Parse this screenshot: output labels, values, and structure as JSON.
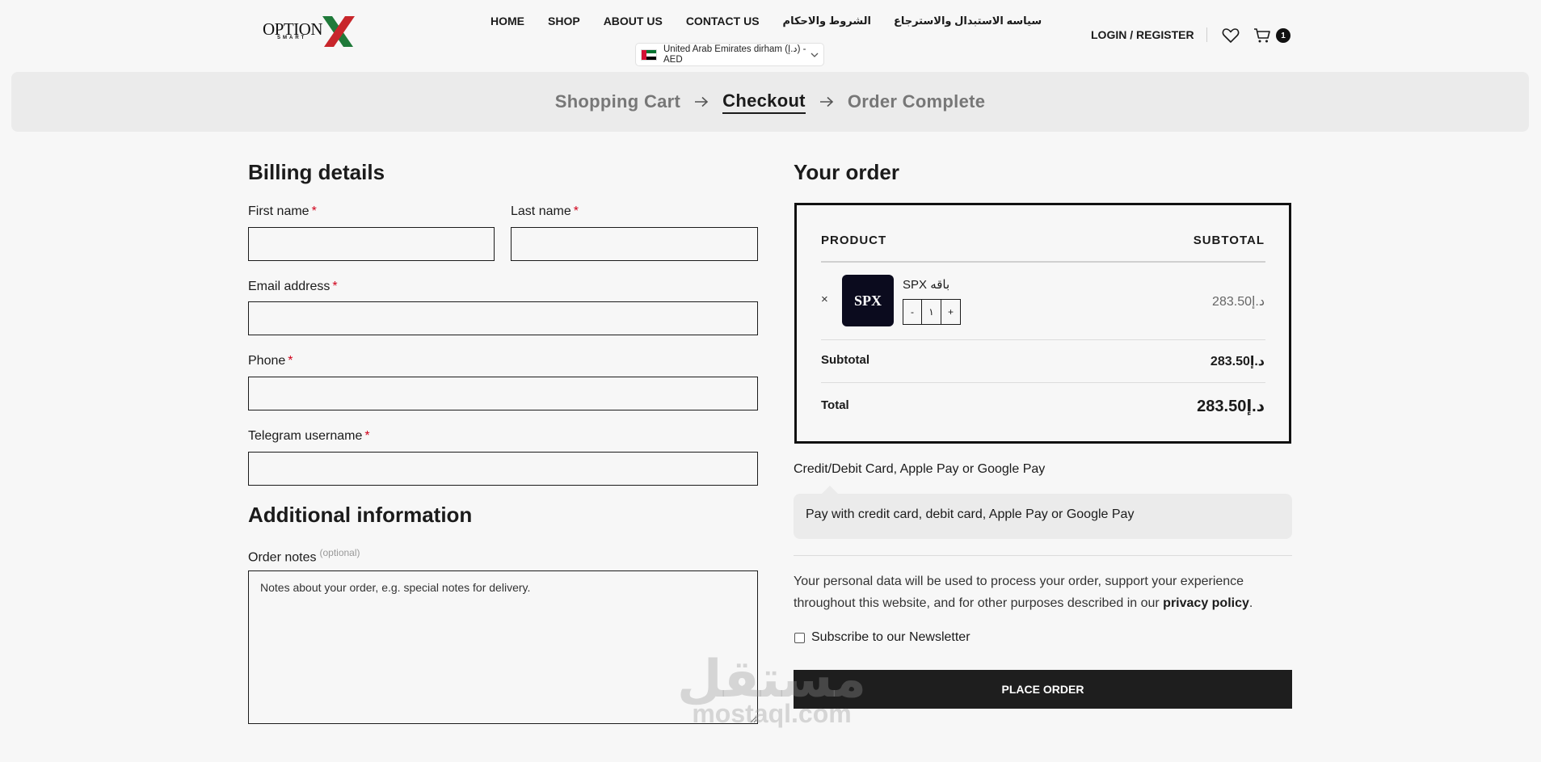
{
  "header": {
    "logo": {
      "text": "OPTION",
      "sub": "SMART"
    },
    "nav": [
      "HOME",
      "SHOP",
      "ABOUT US",
      "CONTACT US",
      "الشروط والاحكام",
      "سياسه الاستبدال والاسترجاع"
    ],
    "currency": "United Arab Emirates dirham (د.إ) - AED",
    "login": "LOGIN / REGISTER",
    "cart_count": "1",
    "icons": [
      "heart-icon",
      "cart-icon",
      "chevron-down-icon"
    ]
  },
  "steps": [
    "Shopping Cart",
    "Checkout",
    "Order Complete"
  ],
  "billing": {
    "title": "Billing details",
    "first_name": "First name",
    "last_name": "Last name",
    "email": "Email address",
    "phone": "Phone",
    "telegram": "Telegram username",
    "required_mark": "*"
  },
  "additional": {
    "title": "Additional information",
    "notes_label": "Order notes",
    "optional": "(optional)",
    "notes_placeholder": "Notes about your order, e.g. special notes for delivery."
  },
  "order": {
    "title": "Your order",
    "col_product": "PRODUCT",
    "col_subtotal": "SUBTOTAL",
    "remove": "×",
    "product_name": "SPX باقه",
    "thumb_text": "SPX",
    "qty_minus": "-",
    "qty_value": "١",
    "qty_plus": "+",
    "product_price": "283.50د.إ",
    "subtotal_label": "Subtotal",
    "subtotal_value": "283.50د.إ",
    "total_label": "Total",
    "total_value": "283.50د.إ"
  },
  "payment": {
    "method": "Credit/Debit Card, Apple Pay or Google Pay",
    "description": "Pay with credit card, debit card, Apple Pay or Google Pay",
    "privacy_text": "Your personal data will be used to process your order, support your experience throughout this website, and for other purposes described in our ",
    "privacy_link": "privacy policy",
    "privacy_end": ".",
    "newsletter": "Subscribe to our Newsletter",
    "place_order": "PLACE ORDER"
  },
  "watermark": {
    "arabic": "مستقل",
    "latin": "mostaql.com"
  }
}
